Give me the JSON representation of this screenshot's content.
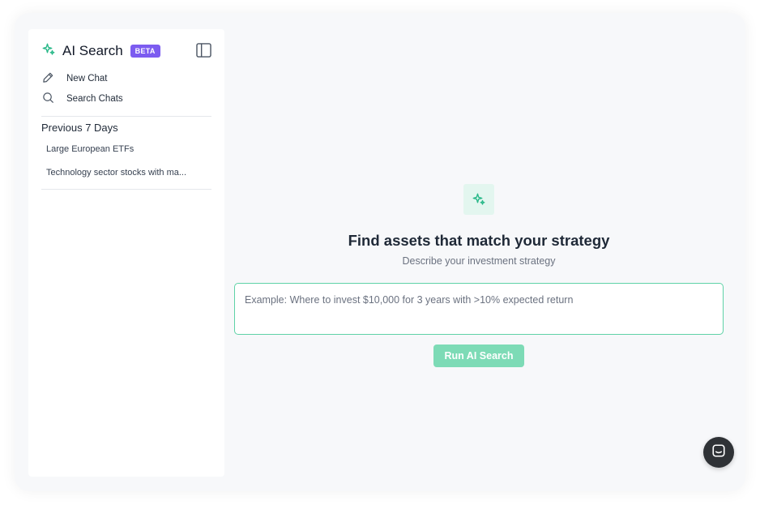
{
  "sidebar": {
    "title": "AI Search",
    "badge": "BETA",
    "actions": [
      {
        "label": "New Chat",
        "icon": "pencil-icon"
      },
      {
        "label": "Search Chats",
        "icon": "search-icon"
      }
    ],
    "section_title": "Previous 7 Days",
    "history": [
      {
        "label": "Large European ETFs"
      },
      {
        "label": "Technology sector stocks with ma..."
      }
    ]
  },
  "main": {
    "headline": "Find assets that match your strategy",
    "subhead": "Describe your investment strategy",
    "prompt_placeholder": "Example: Where to invest $10,000 for 3 years with >10% expected return",
    "prompt_value": "",
    "run_button": "Run AI Search"
  },
  "colors": {
    "accent": "#2bb98a",
    "badge": "#7c5cf0",
    "button": "#7ddbb6",
    "launcher": "#2f3236"
  }
}
